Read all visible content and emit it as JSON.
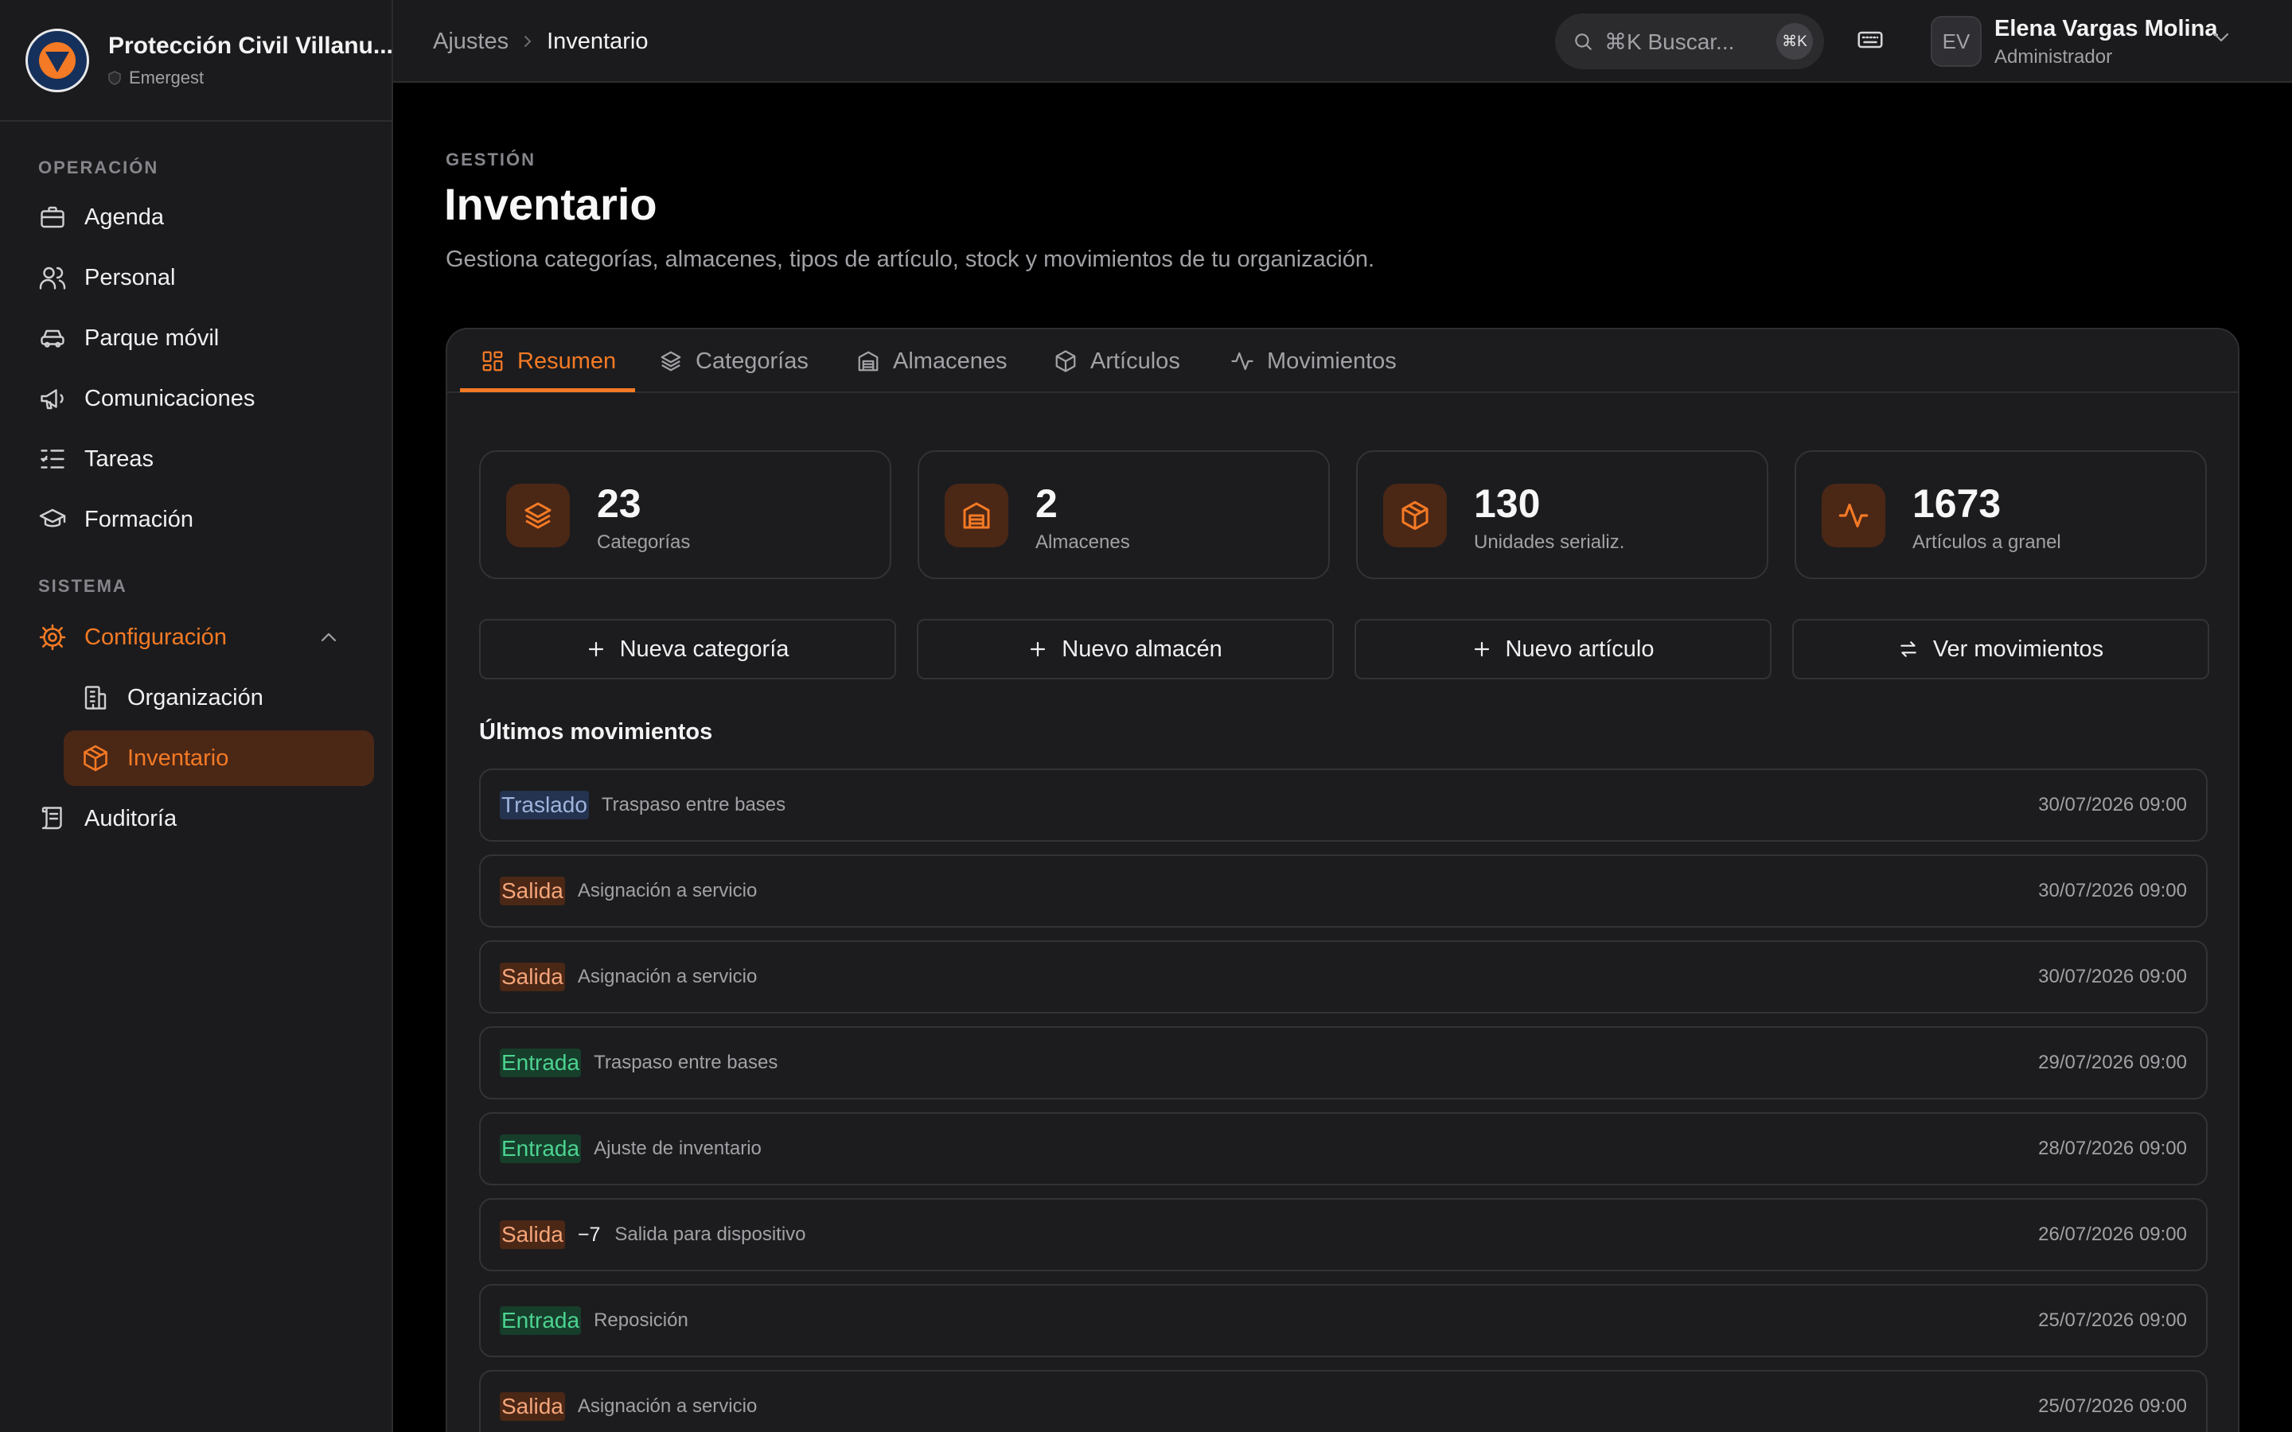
{
  "org": {
    "name": "Protección Civil Villanu...",
    "subtitle": "Emergest"
  },
  "sidebar": {
    "section_operacion": "OPERACIÓN",
    "section_sistema": "SISTEMA",
    "items": [
      {
        "label": "Agenda",
        "icon": "briefcase-icon"
      },
      {
        "label": "Personal",
        "icon": "users-icon"
      },
      {
        "label": "Parque móvil",
        "icon": "car-icon"
      },
      {
        "label": "Comunicaciones",
        "icon": "megaphone-icon"
      },
      {
        "label": "Tareas",
        "icon": "list-checks-icon"
      },
      {
        "label": "Formación",
        "icon": "graduation-cap-icon"
      }
    ],
    "config": {
      "label": "Configuración",
      "icon": "gear-icon"
    },
    "sub_items": [
      {
        "label": "Organización",
        "icon": "building-icon"
      },
      {
        "label": "Inventario",
        "icon": "package-icon"
      }
    ],
    "audit": {
      "label": "Auditoría",
      "icon": "scroll-icon"
    }
  },
  "topbar": {
    "breadcrumb": [
      "Ajustes",
      "Inventario"
    ],
    "search_placeholder": "⌘K Buscar...",
    "search_kbd": "⌘K",
    "user": {
      "initials": "EV",
      "name": "Elena Vargas Molina",
      "role": "Administrador"
    }
  },
  "header": {
    "eyebrow": "GESTIÓN",
    "title": "Inventario",
    "description": "Gestiona categorías, almacenes, tipos de artículo, stock y movimientos de tu organización."
  },
  "tabs": [
    {
      "label": "Resumen",
      "icon": "grid-icon",
      "active": true
    },
    {
      "label": "Categorías",
      "icon": "layers-icon",
      "active": false
    },
    {
      "label": "Almacenes",
      "icon": "warehouse-icon",
      "active": false
    },
    {
      "label": "Artículos",
      "icon": "package-icon",
      "active": false
    },
    {
      "label": "Movimientos",
      "icon": "activity-icon",
      "active": false
    }
  ],
  "stats": [
    {
      "value": "23",
      "label": "Categorías",
      "icon": "layers-icon"
    },
    {
      "value": "2",
      "label": "Almacenes",
      "icon": "warehouse-icon"
    },
    {
      "value": "130",
      "label": "Unidades serializ.",
      "icon": "package-icon"
    },
    {
      "value": "1673",
      "label": "Artículos a granel",
      "icon": "activity-icon"
    }
  ],
  "actions": [
    {
      "label": "Nueva categoría",
      "icon": "plus-icon"
    },
    {
      "label": "Nuevo almacén",
      "icon": "plus-icon"
    },
    {
      "label": "Nuevo artículo",
      "icon": "plus-icon"
    },
    {
      "label": "Ver movimientos",
      "icon": "arrows-swap-icon"
    }
  ],
  "recent": {
    "title": "Últimos movimientos",
    "rows": [
      {
        "type": "Traslado",
        "kind": "traslado",
        "qty": "",
        "desc": "Traspaso entre bases",
        "date": "30/07/2026 09:00"
      },
      {
        "type": "Salida",
        "kind": "salida",
        "qty": "",
        "desc": "Asignación a servicio",
        "date": "30/07/2026 09:00"
      },
      {
        "type": "Salida",
        "kind": "salida",
        "qty": "",
        "desc": "Asignación a servicio",
        "date": "30/07/2026 09:00"
      },
      {
        "type": "Entrada",
        "kind": "entrada",
        "qty": "",
        "desc": "Traspaso entre bases",
        "date": "29/07/2026 09:00"
      },
      {
        "type": "Entrada",
        "kind": "entrada",
        "qty": "",
        "desc": "Ajuste de inventario",
        "date": "28/07/2026 09:00"
      },
      {
        "type": "Salida",
        "kind": "salida",
        "qty": "−7",
        "desc": "Salida para dispositivo",
        "date": "26/07/2026 09:00"
      },
      {
        "type": "Entrada",
        "kind": "entrada",
        "qty": "",
        "desc": "Reposición",
        "date": "25/07/2026 09:00"
      },
      {
        "type": "Salida",
        "kind": "salida",
        "qty": "",
        "desc": "Asignación a servicio",
        "date": "25/07/2026 09:00"
      }
    ]
  },
  "colors": {
    "accent": "#f47a25",
    "accent_bg": "#4b2716",
    "entrada": "#4cd390",
    "traslado": "#9fb4dc"
  }
}
